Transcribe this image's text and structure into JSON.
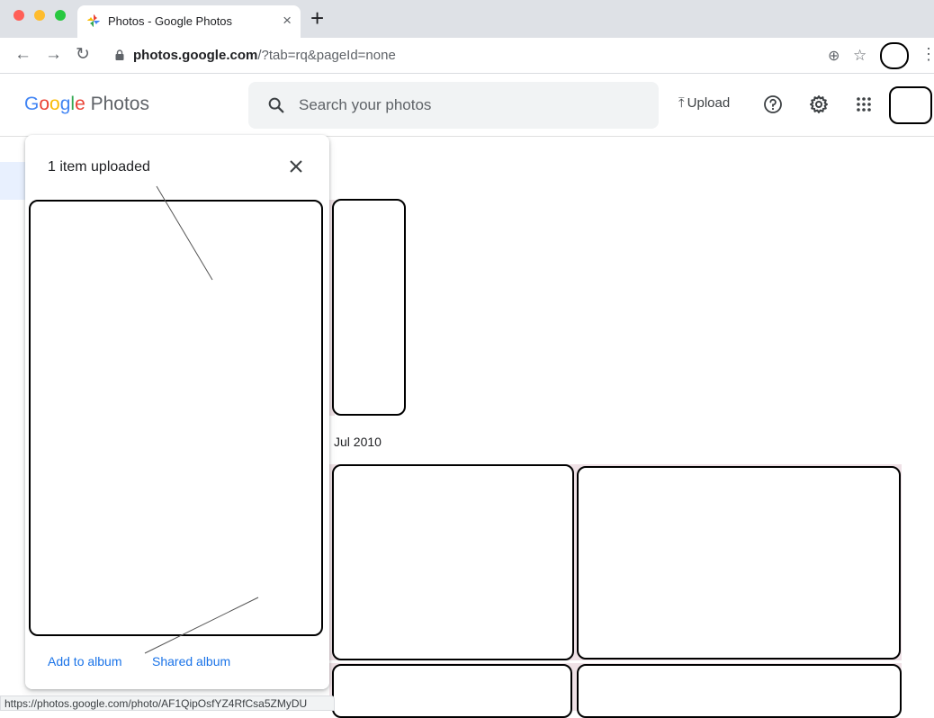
{
  "browser": {
    "tab_title": "Photos - Google Photos",
    "tab_close": "×",
    "new_tab": "+",
    "url_domain": "photos.google.com",
    "url_path": "/?tab=rq&pageId=none"
  },
  "app": {
    "logo_letters": [
      "G",
      "o",
      "o",
      "g",
      "l",
      "e"
    ],
    "logo_product": "Photos",
    "search_placeholder": "Search your photos",
    "upload_label": "Upload",
    "upload_arrow": "⤒"
  },
  "main": {
    "date_label": "Jul 2010"
  },
  "upload_panel": {
    "title": "1 item uploaded",
    "actions": [
      "Add to album",
      "Shared album"
    ]
  },
  "status_bar": {
    "url": "https://photos.google.com/photo/AF1QipOsfYZ4RfCsa5ZMyDU"
  },
  "colors": {
    "accent_link": "#1a73e8",
    "google_blue": "#4285f4",
    "google_red": "#ea4335",
    "google_yellow": "#fbbc05",
    "google_green": "#34a853"
  }
}
